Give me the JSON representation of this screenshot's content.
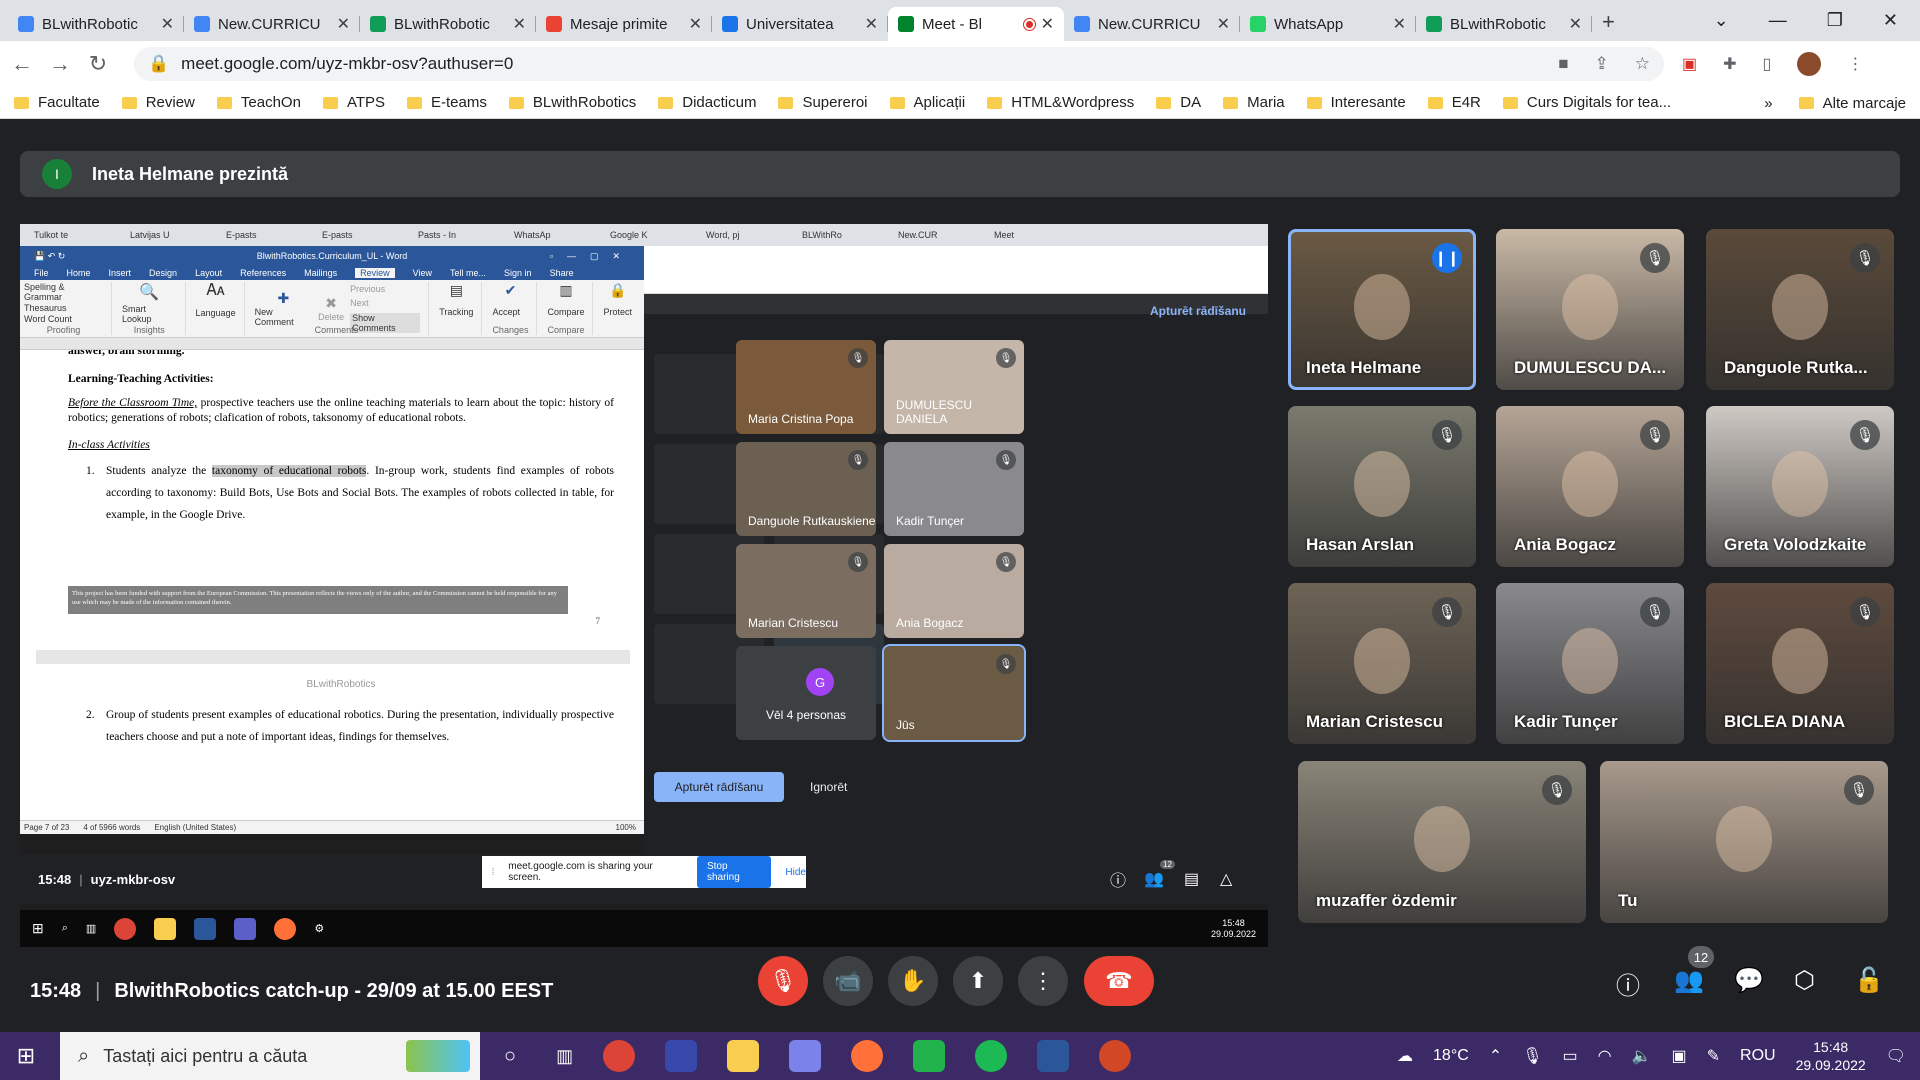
{
  "browser": {
    "tabs": [
      {
        "title": "BLwithRobotic",
        "color": "#4285f4",
        "active": false
      },
      {
        "title": "New.CURRICU",
        "color": "#4285f4",
        "active": false
      },
      {
        "title": "BLwithRobotic",
        "color": "#0f9d58",
        "active": false
      },
      {
        "title": "Mesaje primite",
        "color": "#ea4335",
        "active": false
      },
      {
        "title": "Universitatea",
        "color": "#1a73e8",
        "active": false
      },
      {
        "title": "Meet - Bl",
        "color": "#00832d",
        "active": true
      },
      {
        "title": "New.CURRICU",
        "color": "#4285f4",
        "active": false
      },
      {
        "title": "WhatsApp",
        "color": "#25d366",
        "active": false
      },
      {
        "title": "BLwithRobotic",
        "color": "#0f9d58",
        "active": false
      }
    ],
    "url": "meet.google.com/uyz-mkbr-osv?authuser=0",
    "bookmarks": [
      "Facultate",
      "Review",
      "TeachOn",
      "ATPS",
      "E-teams",
      "BLwithRobotics",
      "Didacticum",
      "Supereroi",
      "Aplicații",
      "HTML&Wordpress",
      "DA",
      "Maria",
      "Interesante",
      "E4R",
      "Curs Digitals for tea..."
    ],
    "bookmarks_more": "»",
    "bookmarks_other": "Alte marcaje"
  },
  "meet": {
    "presenter_initial": "I",
    "presenter_banner": "Ineta Helmane prezintă",
    "clock": "15:48",
    "meeting_title": "BlwithRobotics catch-up - 29/09 at 15.00 EEST",
    "participants_count": "12",
    "tiles": [
      {
        "name": "Ineta Helmane",
        "speaking": true,
        "bg": "#6b5a44"
      },
      {
        "name": "DUMULESCU DA...",
        "speaking": false,
        "bg": "#c9b9a6"
      },
      {
        "name": "Danguole Rutka...",
        "speaking": false,
        "bg": "#5a4a3a"
      },
      {
        "name": "Hasan Arslan",
        "speaking": false,
        "bg": "#7a7a6e"
      },
      {
        "name": "Ania Bogacz",
        "speaking": false,
        "bg": "#b5a596"
      },
      {
        "name": "Greta Volodzkaite",
        "speaking": false,
        "bg": "#cfc9c4"
      },
      {
        "name": "Marian Cristescu",
        "speaking": false,
        "bg": "#6e6456"
      },
      {
        "name": "Kadir Tunçer",
        "speaking": false,
        "bg": "#8a8a8e"
      },
      {
        "name": "BICLEA DIANA",
        "speaking": false,
        "bg": "#5e4a3e"
      },
      {
        "name": "muzaffer özdemir",
        "speaking": false,
        "bg": "#8a8478"
      },
      {
        "name": "Tu",
        "speaking": false,
        "bg": "#a89a8c"
      }
    ]
  },
  "shared": {
    "inner_tabs": [
      "Tulkot te",
      "Latvijas U",
      "E-pasts",
      "E-pasts",
      "Pasts - In",
      "WhatsAp",
      "Google K",
      "Word, pj",
      "BLWithRo",
      "New.CUR",
      "Meet"
    ],
    "word_title": "BlwithRobotics.Curriculum_UL - Word",
    "word_menu": [
      "File",
      "Home",
      "Insert",
      "Design",
      "Layout",
      "References",
      "Mailings",
      "Review",
      "View",
      "Tell me...",
      "Sign in",
      "Share"
    ],
    "ribbon": {
      "spelling": "Spelling & Grammar",
      "thesaurus": "Thesaurus",
      "wordcount": "Word Count",
      "proofing": "Proofing",
      "smart": "Smart Lookup",
      "insights": "Insights",
      "language": "Language",
      "newcomment": "New Comment",
      "delete": "Delete",
      "previous": "Previous",
      "next": "Next",
      "show": "Show Comments",
      "comments": "Comments",
      "tracking": "Tracking",
      "accept": "Accept",
      "changes": "Changes",
      "compare": "Compare",
      "protect": "Protect",
      "compare_grp": "Compare"
    },
    "doc": {
      "cut_line": "answer, brain storming.",
      "heading": "Learning-Teaching Activities:",
      "before_label": "Before the Classroom Time,",
      "before_text": " prospective teachers use the online teaching materials to learn about the topic: history of robotics; generations of robots; clafication of robots, taksonomy of educational robots.",
      "inclass": "In-class Activities",
      "item1_num": "1.",
      "item1_pre": "Students analyze the ",
      "item1_hl": "taxonomy of educational robots",
      "item1_post": ". In-group work, students find examples of robots according to taxonomy: Build Bots, Use Bots and Social Bots. The examples of robots collected in table, for example, in the Google Drive.",
      "footer_text": "This project has been funded with support from the European Commission. This presentation reflects the views only of the author, and the Commission cannot be held responsible for any use which may be made of the information contained therein.",
      "page_number": "7",
      "header2": "BLwithRobotics",
      "item2_num": "2.",
      "item2_text": "Group of students present examples of educational robotics.  During the presentation, individually prospective teachers choose and put a note of important ideas, findings for themselves."
    },
    "status": [
      "Page 7 of 23",
      "4 of 5966 words",
      "English (United States)",
      "100%"
    ],
    "inner_stop_rec": "Apturēt rādīšanu",
    "inner_tiles": [
      "Maria Cristina Popa",
      "DUMULESCU DANIELA",
      "Danguole Rutkauskiene",
      "Kadir Tunçer",
      "Marian Cristescu",
      "Ania Bogacz",
      "Vēl 4 personas",
      "Jūs"
    ],
    "inner_more_initial": "G",
    "stop_rec_btn": "Apturēt rādīšanu",
    "ignore": "Ignorēt",
    "inner_clock": "15:48",
    "inner_code": "uyz-mkbr-osv",
    "inner_count": "12",
    "share_msg": "meet.google.com is sharing your screen.",
    "stop_sharing": "Stop sharing",
    "hide": "Hide",
    "inner_time": "15:48",
    "inner_date": "29.09.2022"
  },
  "taskbar": {
    "search_placeholder": "Tastați aici pentru a căuta",
    "temperature": "18°C",
    "lang": "ROU",
    "time": "15:48",
    "date": "29.09.2022"
  }
}
